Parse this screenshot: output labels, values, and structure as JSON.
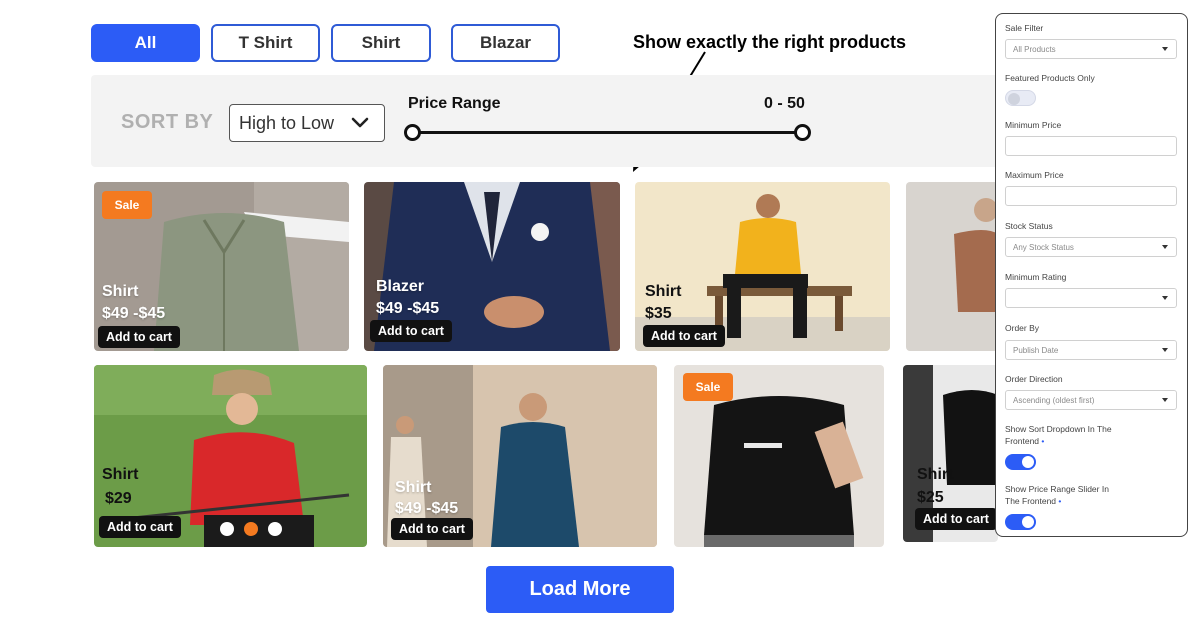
{
  "filter_tabs": [
    {
      "label": "All",
      "active": true
    },
    {
      "label": "T Shirt",
      "active": false
    },
    {
      "label": "Shirt",
      "active": false
    },
    {
      "label": "Blazar",
      "active": false
    }
  ],
  "annotation": "Show exactly the right products",
  "sort": {
    "label": "SORT BY",
    "selected": "High to Low",
    "price_label": "Price Range",
    "price_value": "0 - 50"
  },
  "products": [
    {
      "title": "Shirt",
      "price": "$49 -$45",
      "cart": "Add to cart",
      "badge": "Sale"
    },
    {
      "title": "Blazer",
      "price": "$49 -$45",
      "cart": "Add to cart"
    },
    {
      "title": "Shirt",
      "price": "$35",
      "cart": "Add to cart"
    },
    {
      "title": "",
      "price": "",
      "cart": ""
    },
    {
      "title": "Shirt",
      "price": "$29",
      "cart": "Add to cart"
    },
    {
      "title": "Shirt",
      "price": "$49 -$45",
      "cart": "Add to cart"
    },
    {
      "title": "",
      "price": "",
      "cart": "",
      "badge": "Sale"
    },
    {
      "title": "Shirt",
      "price": "$25",
      "cart": "Add to cart"
    }
  ],
  "carousel": {
    "count": 3,
    "active_index": 1
  },
  "load_more": "Load More",
  "settings_panel": {
    "sale_filter_label": "Sale Filter",
    "sale_filter_value": "All Products",
    "featured_label": "Featured Products Only",
    "featured_on": false,
    "min_price_label": "Minimum Price",
    "min_price_value": "",
    "max_price_label": "Maximum Price",
    "max_price_value": "",
    "stock_label": "Stock Status",
    "stock_value": "Any Stock Status",
    "rating_label": "Minimum Rating",
    "rating_value": "",
    "order_by_label": "Order By",
    "order_by_value": "Publish Date",
    "order_dir_label": "Order Direction",
    "order_dir_value": "Ascending (oldest first)",
    "sort_dropdown_label_1": "Show Sort Dropdown In The",
    "sort_dropdown_label_2": "Frontend",
    "sort_dropdown_on": true,
    "price_slider_label_1": "Show Price Range Slider In",
    "price_slider_label_2": "The Frontend",
    "price_slider_on": true,
    "required_mark": "•"
  },
  "colors": {
    "accent": "#2c5cf6",
    "sale": "#f47a20",
    "sortbar_bg": "#f3f3f3"
  }
}
